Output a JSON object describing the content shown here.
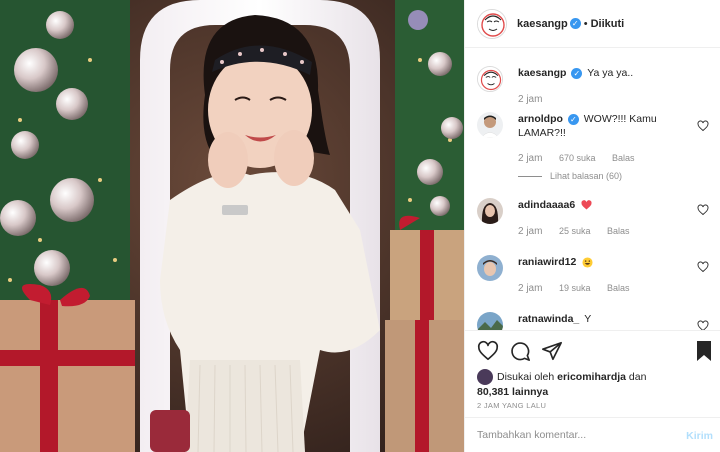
{
  "post": {
    "username": "kaesangp",
    "verified_mark": "✓",
    "separator": "•",
    "follow_status": "Diikuti",
    "avatar_icon": "cartoon-face-avatar"
  },
  "caption": {
    "username": "kaesangp",
    "text": "Ya ya ya..",
    "time": "2 jam"
  },
  "comments": [
    {
      "username": "arnoldpo",
      "verified": true,
      "text": "WOW?!!! Kamu LAMAR?!!",
      "time": "2 jam",
      "likes": "670 suka",
      "reply": "Balas",
      "view_replies": "Lihat balasan (60)"
    },
    {
      "username": "adindaaaa6",
      "text": "",
      "emoji": "red-heart",
      "time": "2 jam",
      "likes": "25 suka",
      "reply": "Balas"
    },
    {
      "username": "raniawird12",
      "text": "",
      "emoji": "grinning-face",
      "time": "2 jam",
      "likes": "19 suka",
      "reply": "Balas"
    },
    {
      "username": "ratnawinda_",
      "text": "Y"
    }
  ],
  "liked_by": {
    "prefix": "Disukai oleh",
    "user": "ericomihardja",
    "joiner": "dan",
    "others": "80,381 lainnya"
  },
  "timestamp": "2 JAM YANG LALU",
  "add_comment": {
    "placeholder": "Tambahkan komentar...",
    "send_label": "Kirim"
  },
  "colors": {
    "verified_blue": "#3897f0",
    "muted_gray": "#8e8e8e",
    "send_disabled": "#b2dffc",
    "heart_red": "#ed4956"
  },
  "icons": [
    "heart-icon",
    "comment-icon",
    "share-icon",
    "bookmark-icon"
  ]
}
